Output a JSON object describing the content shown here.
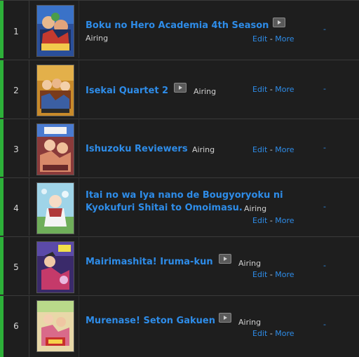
{
  "columns": {
    "edit_label": "Edit",
    "more_label": "More",
    "separator": "-",
    "score_placeholder": "-"
  },
  "colors": {
    "accent": "#2db039",
    "link": "#2e8ce8",
    "background": "#1e1e1e"
  },
  "rows": [
    {
      "number": "1",
      "title": "Boku no Hero Academia 4th Season",
      "status": "Airing",
      "has_stream_icon": true
    },
    {
      "number": "2",
      "title": "Isekai Quartet 2",
      "status": "Airing",
      "has_stream_icon": true
    },
    {
      "number": "3",
      "title": "Ishuzoku Reviewers",
      "status": "Airing",
      "has_stream_icon": false
    },
    {
      "number": "4",
      "title_line1": "Itai no wa Iya nano de Bougyoryoku ni",
      "title_line2": "Kyokufuri Shitai to Omoimasu.",
      "status": "Airing",
      "has_stream_icon": false
    },
    {
      "number": "5",
      "title": "Mairimashita! Iruma-kun",
      "status": "Airing",
      "has_stream_icon": true
    },
    {
      "number": "6",
      "title": "Murenase! Seton Gakuen",
      "status": "Airing",
      "has_stream_icon": true
    }
  ]
}
